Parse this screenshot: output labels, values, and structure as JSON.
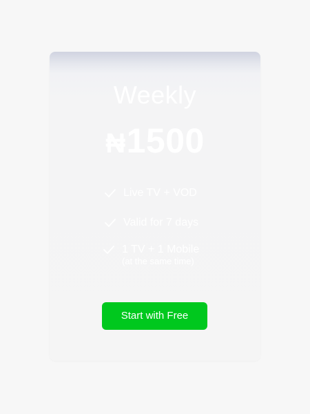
{
  "plan": {
    "title": "Weekly",
    "currency": "₦",
    "amount": "1500"
  },
  "features": [
    {
      "text": "Live TV + VOD",
      "icon": "check-icon"
    },
    {
      "text": "Valid for 7 days",
      "icon": "check-icon"
    },
    {
      "text": "1 TV + 1 Mobile",
      "subtext": "(at the same time)",
      "icon": "check-icon"
    }
  ],
  "cta": {
    "label": "Start with Free"
  },
  "colors": {
    "page_background": "#f7f7f7",
    "card_top": "#d0d3e0",
    "card_background": "#f5f5f5",
    "accent_green": "#00c81e",
    "text_white": "#ffffff"
  }
}
